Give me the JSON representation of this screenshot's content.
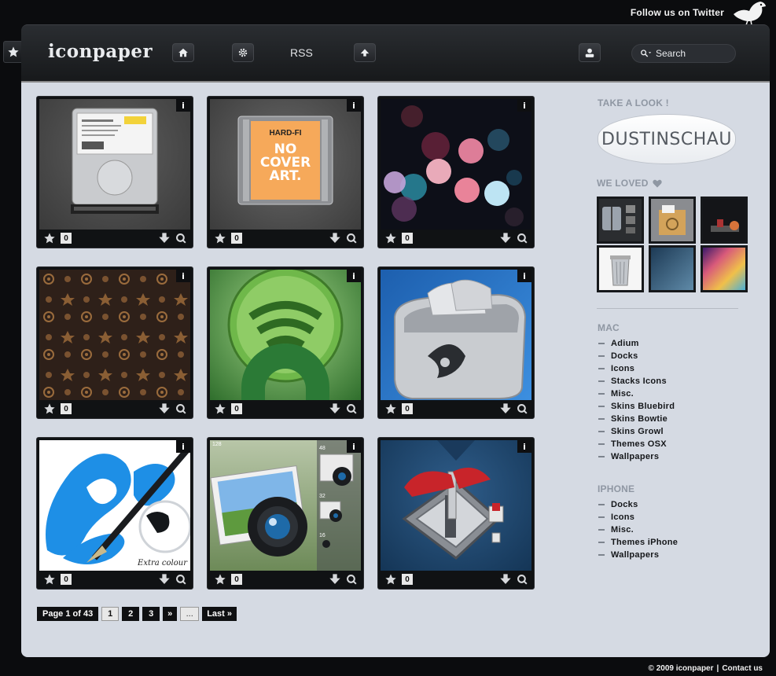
{
  "twitter": {
    "text": "Follow us on Twitter"
  },
  "header": {
    "logo": "iconpaper",
    "rss_label": "RSS",
    "search_placeholder": "Search"
  },
  "cards": [
    {
      "id": "harddrive",
      "likes": "0",
      "info": "i"
    },
    {
      "id": "nocover",
      "likes": "0",
      "info": "i",
      "text_top": "HARD-FI",
      "text_big": "NO COVER ART."
    },
    {
      "id": "bokeh",
      "likes": "0",
      "info": "i"
    },
    {
      "id": "pattern",
      "likes": "0",
      "info": "i"
    },
    {
      "id": "greenfeed",
      "likes": "0",
      "info": "i"
    },
    {
      "id": "toaster",
      "likes": "0",
      "info": "i"
    },
    {
      "id": "paint",
      "likes": "0",
      "info": "i",
      "caption": "Extra colour"
    },
    {
      "id": "photo",
      "likes": "0",
      "info": "i",
      "sizes": [
        "128",
        "48",
        "32",
        "16"
      ]
    },
    {
      "id": "gear",
      "likes": "0",
      "info": "i"
    }
  ],
  "pager": {
    "label": "Page 1 of 43",
    "pages": [
      "1",
      "2",
      "3"
    ],
    "next": "»",
    "dots": "...",
    "last": "Last »"
  },
  "sidebar": {
    "take_a_look": "TAKE A LOOK !",
    "dustin": "DUSTINSCHAU",
    "we_loved": "WE LOVED",
    "mac_title": "MAC",
    "mac_items": [
      "Adium",
      "Docks",
      "Icons",
      "Stacks Icons",
      "Misc.",
      "Skins Bluebird",
      "Skins Bowtie",
      "Skins Growl",
      "Themes OSX",
      "Wallpapers"
    ],
    "iphone_title": "IPHONE",
    "iphone_items": [
      "Docks",
      "Icons",
      "Misc.",
      "Themes iPhone",
      "Wallpapers"
    ]
  },
  "footer": {
    "copyright": "© 2009 iconpaper",
    "sep": "|",
    "contact": "Contact us"
  },
  "colors": {
    "content_bg": "#d5dae3",
    "header_bg": "#1f2125",
    "accent_card": "#101214"
  }
}
